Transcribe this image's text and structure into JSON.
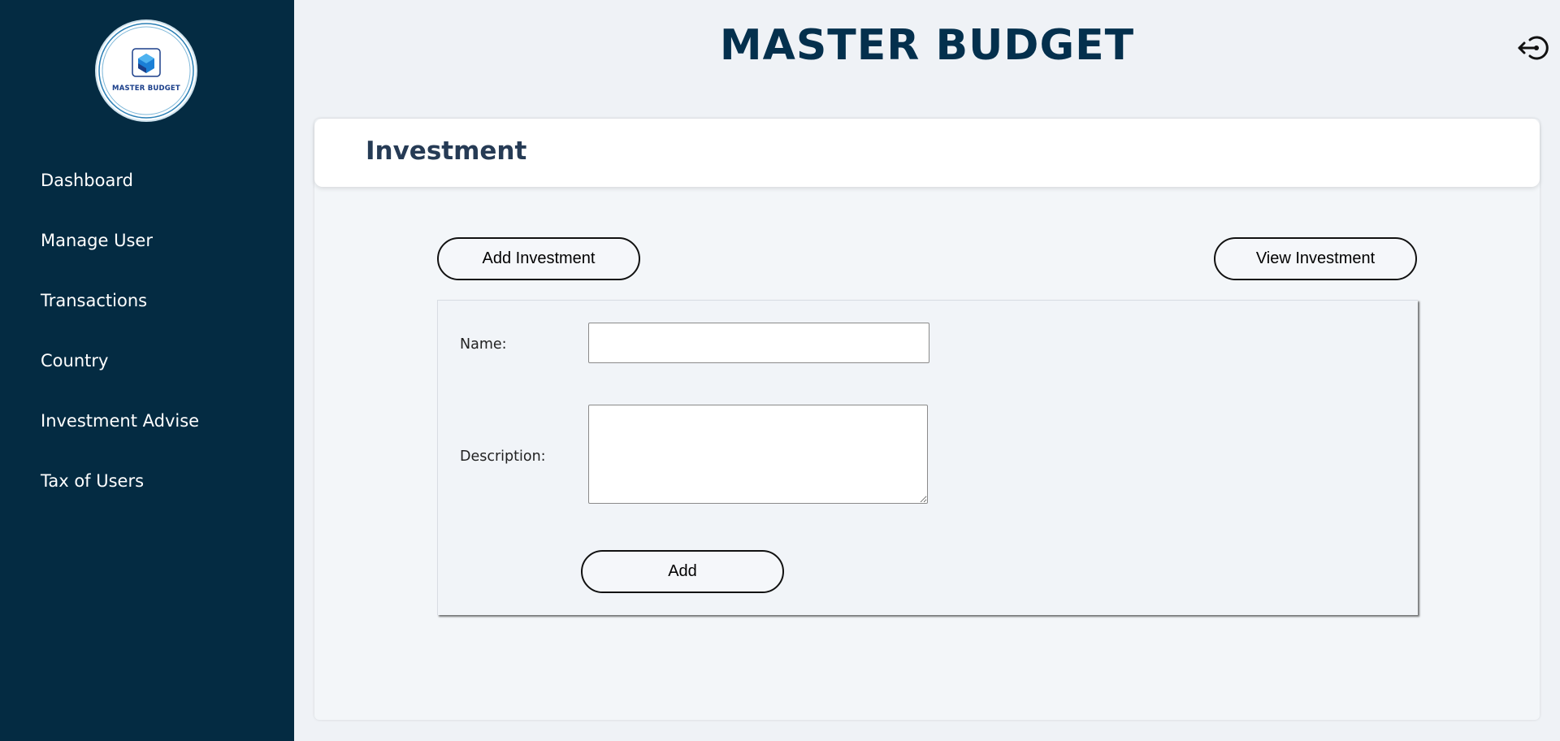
{
  "brand": {
    "logo_text": "MASTER BUDGET",
    "colors": {
      "sidebar": "#042b42",
      "title": "#04304d",
      "accent": "#1b7fd6"
    }
  },
  "sidebar": {
    "items": [
      {
        "label": "Dashboard"
      },
      {
        "label": "Manage User"
      },
      {
        "label": "Transactions"
      },
      {
        "label": "Country"
      },
      {
        "label": "Investment Advise"
      },
      {
        "label": "Tax of Users"
      }
    ]
  },
  "header": {
    "title": "MASTER BUDGET",
    "logout_icon": "logout-icon"
  },
  "main": {
    "section_title": "Investment",
    "add_investment_label": "Add Investment",
    "view_investment_label": "View Investment",
    "form": {
      "name_label": "Name:",
      "name_value": "",
      "description_label": "Description:",
      "description_value": "",
      "submit_label": "Add"
    }
  }
}
